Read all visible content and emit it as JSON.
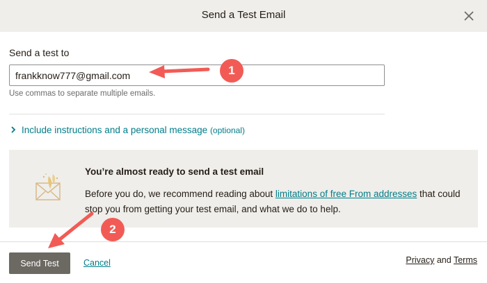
{
  "dialog": {
    "title": "Send a Test Email",
    "close_icon": "close-icon"
  },
  "form": {
    "label": "Send a test to",
    "email_value": "frankknow777@gmail.com",
    "helper": "Use commas to separate multiple emails.",
    "expand_label": "Include instructions and a personal message",
    "expand_optional": "(optional)"
  },
  "notice": {
    "icon": "envelope-icon",
    "title": "You’re almost ready to send a test email",
    "body_before": "Before you do, we recommend reading about ",
    "link_text": "limitations of free From addresses",
    "body_after": " that could stop you from getting your test email, and what we do to help."
  },
  "footer": {
    "send_label": "Send Test",
    "cancel_label": "Cancel",
    "privacy_label": "Privacy",
    "and_text": "and",
    "terms_label": "Terms"
  },
  "annotations": {
    "badge_1": "1",
    "badge_2": "2",
    "color": "#f25b55"
  },
  "colors": {
    "accent": "#007c89",
    "header_bg": "#efeeea",
    "button_bg": "#6c6962"
  }
}
